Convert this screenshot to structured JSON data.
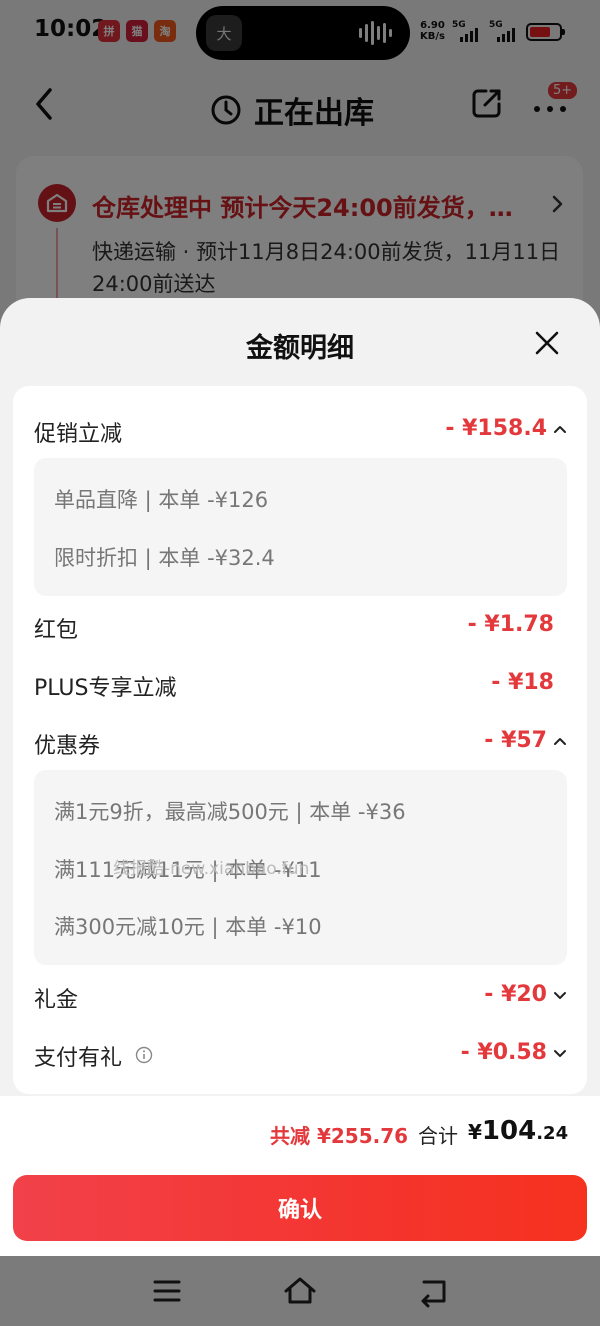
{
  "status_bar": {
    "time": "10:02",
    "app_icons": [
      {
        "name": "app-1",
        "glyph": "拼",
        "color": "#e0303a"
      },
      {
        "name": "app-2",
        "glyph": "猫",
        "color": "#d21f3a"
      },
      {
        "name": "app-3",
        "glyph": "淘",
        "color": "#f25a1c"
      }
    ],
    "island_thumb": "大",
    "net_speed_value": "6.90",
    "net_speed_unit": "KB/s",
    "signal_1": "5G",
    "signal_2": "5G"
  },
  "header": {
    "title": "正在出库",
    "badge": "5+"
  },
  "order_status": {
    "title": "仓库处理中 预计今天24:00前发货，…",
    "subtitle": "快递运输 · 预计11月8日24:00前发货，11月11日24:00前送达"
  },
  "sheet": {
    "title": "金额明细",
    "rows": [
      {
        "label": "促销立减",
        "amount": "- ¥158.4",
        "expanded": true
      },
      {
        "label": "红包",
        "amount": "- ¥1.78"
      },
      {
        "label": "PLUS专享立减",
        "amount": "- ¥18"
      },
      {
        "label": "优惠券",
        "amount": "- ¥57",
        "expanded": true
      },
      {
        "label": "礼金",
        "amount": "- ¥20",
        "expanded": false
      },
      {
        "label": "支付有礼",
        "amount": "- ¥0.58",
        "expanded": false
      }
    ],
    "promo_details": [
      "单品直降 | 本单 -¥126",
      "限时折扣 | 本单 -¥32.4"
    ],
    "coupon_details": [
      "满1元9折，最高减500元 | 本单 -¥36",
      "满111元减11元 | 本单 -¥11",
      "满300元减10元 | 本单 -¥10"
    ],
    "watermark": "线报酷-new.xianbao.fun"
  },
  "footer": {
    "total_reduce": "共减 ¥255.76",
    "total_label": "合计",
    "total_currency": "¥",
    "total_integer": "104",
    "total_decimal": ".24",
    "confirm_label": "确认"
  },
  "colors": {
    "accent": "#e4393c",
    "warehouse_red": "#c8232a"
  }
}
